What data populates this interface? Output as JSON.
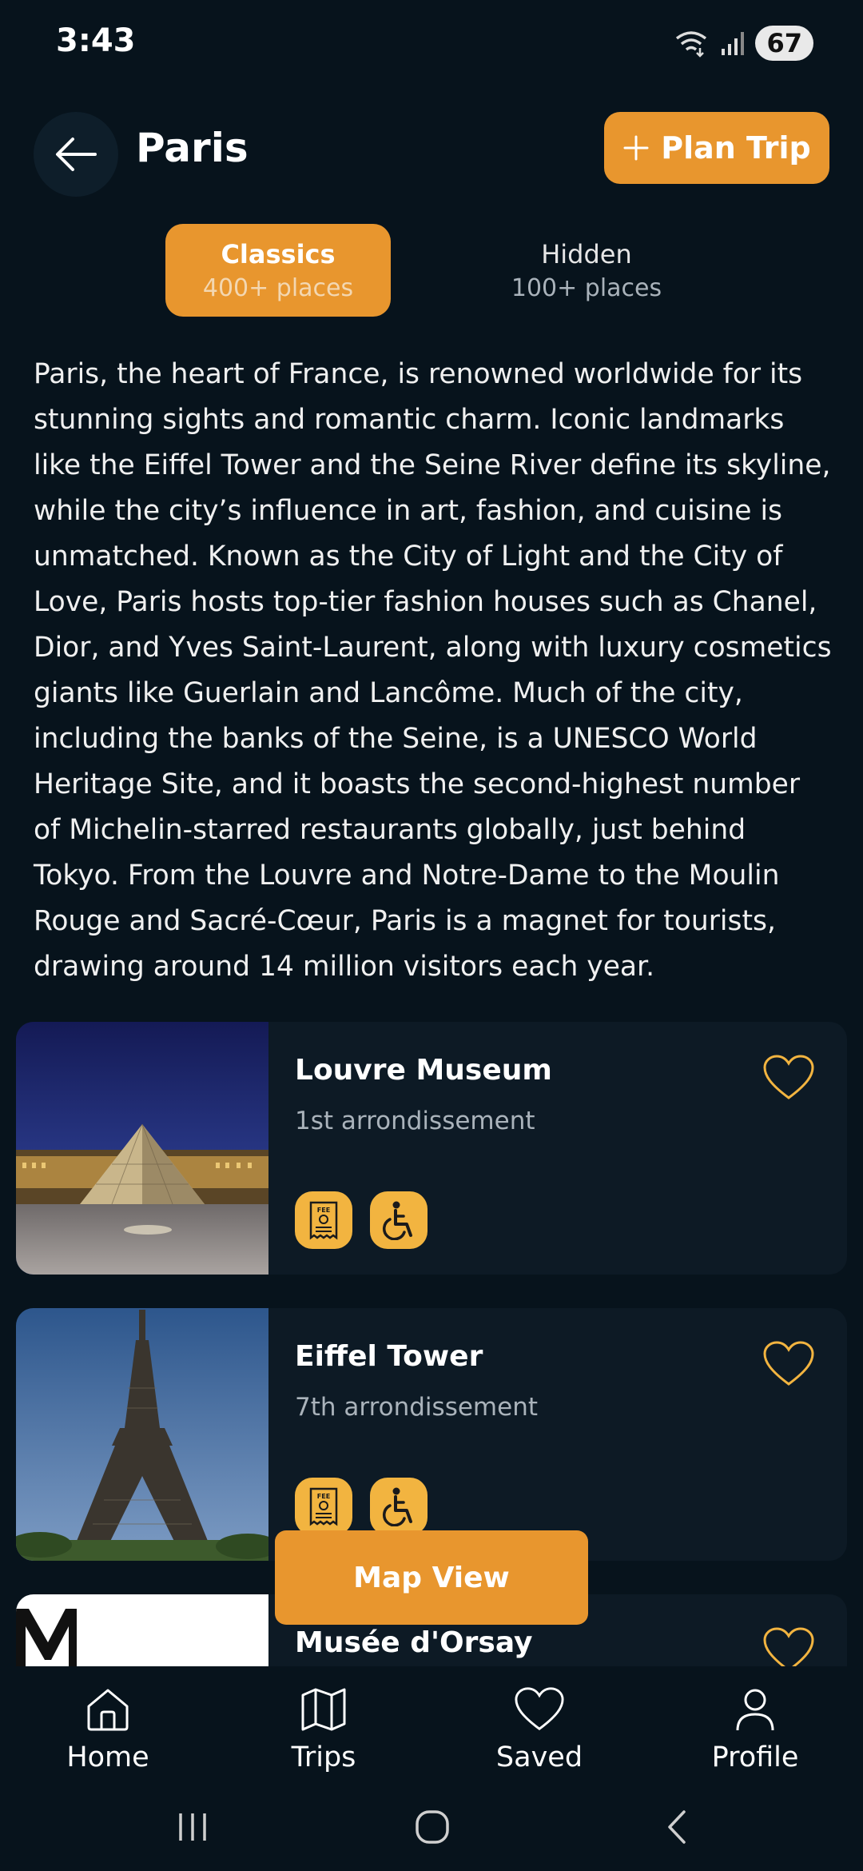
{
  "status": {
    "time": "3:43",
    "battery": "67"
  },
  "header": {
    "title": "Paris",
    "plan_trip_label": "Plan Trip"
  },
  "tabs": [
    {
      "label": "Classics",
      "count": "400+ places"
    },
    {
      "label": "Hidden",
      "count": "100+ places"
    }
  ],
  "description": "Paris, the heart of France, is renowned worldwide for its stunning sights and romantic charm. Iconic landmarks like the Eiffel Tower and the Seine River define its skyline, while the city’s influence in art, fashion, and cuisine is unmatched. Known as the City of Light and the City of Love, Paris hosts top-tier fashion houses such as Chanel, Dior, and Yves Saint-Laurent, along with luxury cosmetics giants like Guerlain and Lancôme. Much of the city, including the banks of the Seine, is a UNESCO World Heritage Site, and it boasts the second-highest number of Michelin-starred restaurants globally, just behind Tokyo. From the Louvre and Notre-Dame to the Moulin Rouge and Sacré-Cœur, Paris is a magnet for tourists, drawing around 14 million visitors each year.",
  "places": [
    {
      "name": "Louvre Museum",
      "area": "1st arrondissement"
    },
    {
      "name": "Eiffel Tower",
      "area": "7th arrondissement"
    },
    {
      "name": "Musée d'Orsay",
      "area": ""
    }
  ],
  "map_view_label": "Map View",
  "nav": [
    {
      "label": "Home",
      "icon": "home-icon"
    },
    {
      "label": "Trips",
      "icon": "map-icon"
    },
    {
      "label": "Saved",
      "icon": "heart-icon"
    },
    {
      "label": "Profile",
      "icon": "user-icon"
    }
  ],
  "colors": {
    "accent": "#e8962e",
    "background": "#07131c",
    "card": "#0d1a25",
    "badge": "#f2b440"
  }
}
